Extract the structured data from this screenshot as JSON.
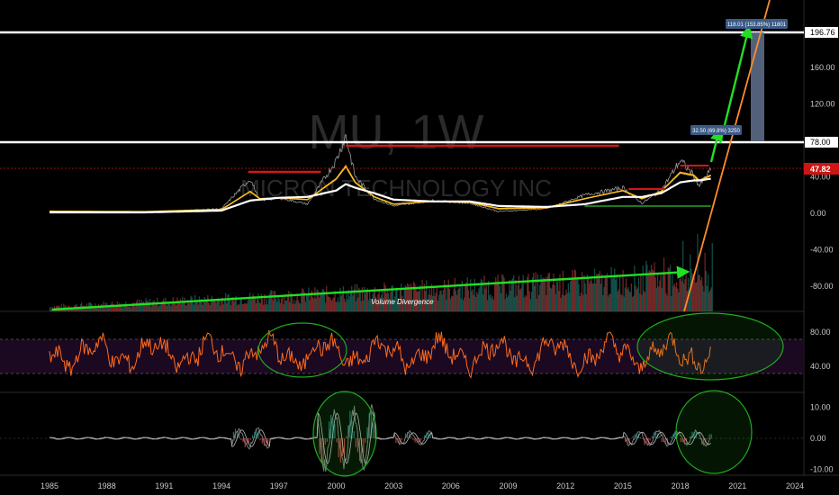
{
  "watermark": {
    "symbol": "MU, 1W",
    "company": "MICRON TECHNOLOGY INC"
  },
  "colors": {
    "background": "#000000",
    "price": "#9a9a9a",
    "ma_fast": "#f5c518",
    "ma_mid": "#ff9a2a",
    "ma_slow": "#ffffff",
    "resistance": "#d01919",
    "support": "#1f7a1f",
    "arrow": "#22e022",
    "trendline": "#ff8c2a",
    "rsi": "#ff6a1a",
    "rsi_band": "#1e0a26",
    "macd": "#7a7a7a",
    "hist_up": "#26a69a",
    "hist_down": "#ef5350",
    "ellipse": "#1faa1f",
    "price_tag": "#cc1515",
    "measure_tag": "#3c5a86"
  },
  "chart_data": [
    {
      "type": "line",
      "panel": "price",
      "x": [
        1985,
        1990,
        1994,
        1995.5,
        1996,
        1997,
        1998.5,
        2000,
        2000.5,
        2001,
        2002,
        2003,
        2005,
        2007,
        2008.5,
        2011,
        2013,
        2015,
        2016,
        2017,
        2018,
        2018.7,
        2019,
        2019.6
      ],
      "series": [
        {
          "values": [
            2,
            1,
            5,
            38,
            14,
            17,
            10,
            58,
            85,
            40,
            16,
            8,
            14,
            11,
            2,
            5,
            20,
            28,
            11,
            25,
            58,
            42,
            30,
            47.82
          ]
        },
        {
          "values": [
            2,
            1.5,
            4,
            24,
            16,
            17,
            15,
            38,
            52,
            34,
            18,
            10,
            13,
            12,
            5,
            6,
            16,
            25,
            16,
            24,
            45,
            42,
            36,
            42
          ]
        },
        {
          "values": [
            1,
            1,
            3,
            14,
            15,
            17,
            18,
            25,
            32,
            28,
            22,
            15,
            13,
            13,
            8,
            7,
            10,
            18,
            18,
            22,
            34,
            36,
            36,
            38
          ]
        }
      ],
      "y_ticks": [
        -80,
        -40,
        0,
        40,
        78,
        120,
        160,
        196.76
      ],
      "levels": [
        78,
        196.76
      ],
      "last_value": 47.82,
      "annotations": [
        "118.01 (153.85%) 11801",
        "32.50 (69.8%) 3250",
        "Volume Divergence"
      ]
    },
    {
      "type": "line",
      "panel": "rsi",
      "y_ticks": [
        40,
        80
      ],
      "band": [
        30,
        70
      ]
    },
    {
      "type": "line",
      "panel": "macd",
      "y_ticks": [
        -10,
        0,
        10
      ]
    }
  ],
  "x_axis": [
    "1985",
    "1988",
    "1991",
    "1994",
    "1997",
    "2000",
    "2003",
    "2006",
    "2009",
    "2012",
    "2015",
    "2018",
    "2021",
    "2024"
  ],
  "price_axis_labels": [
    {
      "v": 196.76,
      "text": "196.76"
    },
    {
      "v": 160,
      "text": "160.00"
    },
    {
      "v": 120,
      "text": "120.00"
    },
    {
      "v": 78,
      "text": "78.00"
    },
    {
      "v": 40,
      "text": "40.00"
    },
    {
      "v": 0,
      "text": "0.00"
    },
    {
      "v": -40,
      "text": "-40.00"
    },
    {
      "v": -80,
      "text": "-80.00"
    }
  ],
  "price_tag": "47.82",
  "rsi_axis_labels": [
    {
      "v": 80,
      "text": "80.00"
    },
    {
      "v": 40,
      "text": "40.00"
    }
  ],
  "macd_axis_labels": [
    {
      "v": 10,
      "text": "10.00"
    },
    {
      "v": 0,
      "text": "0.00"
    },
    {
      "v": -10,
      "text": "-10.00"
    }
  ],
  "measure_top": "118.01 (153.85%) 11801",
  "measure_mid": "32.50 (69.8%) 3250",
  "volume_note": "Volume Divergence"
}
